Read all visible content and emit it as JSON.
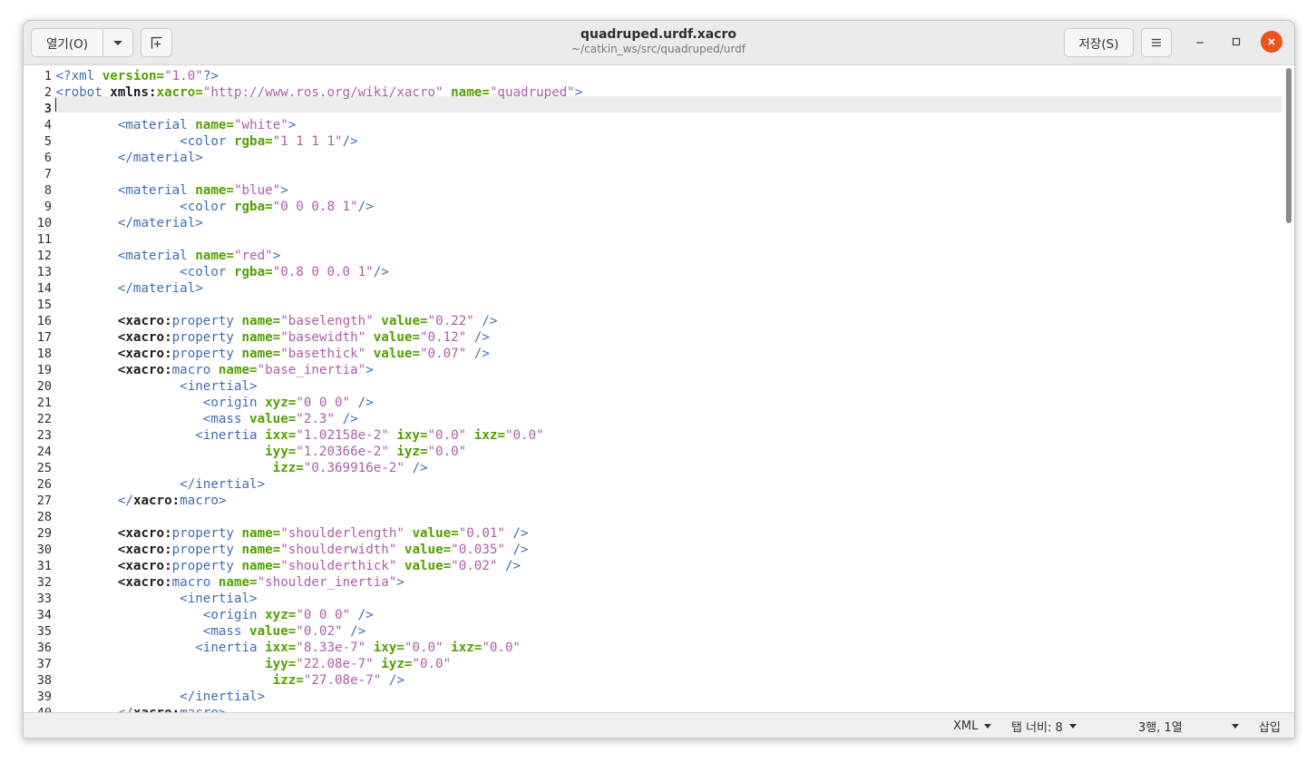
{
  "header": {
    "open_label": "열기(O)",
    "title": "quadruped.urdf.xacro",
    "subtitle": "~/catkin_ws/src/quadruped/urdf",
    "save_label": "저장(S)"
  },
  "icons": {
    "open_dropdown": "chevron-down-icon",
    "new_tab": "new-tab-icon",
    "menu": "hamburger-menu-icon",
    "minimize": "minimize-icon",
    "maximize": "maximize-icon",
    "close": "close-icon"
  },
  "colors": {
    "tag": "#3e6eb4",
    "attribute": "#52a000",
    "string": "#b05cab",
    "namespace": "#1c1c1c",
    "close_button": "#e95420",
    "current_line": "#ededed"
  },
  "editor": {
    "current_line": 3,
    "lines": [
      [
        [
          "t",
          "<?xml "
        ],
        [
          "a",
          "version="
        ],
        [
          "s",
          "\"1.0\""
        ],
        [
          "t",
          "?>"
        ]
      ],
      [
        [
          "t",
          "<robot "
        ],
        [
          "n",
          "xmlns:"
        ],
        [
          "a",
          "xacro="
        ],
        [
          "s",
          "\"http://www.ros.org/wiki/xacro\""
        ],
        [
          "p",
          " "
        ],
        [
          "a",
          "name="
        ],
        [
          "s",
          "\"quadruped\""
        ],
        [
          "t",
          ">"
        ]
      ],
      [],
      [
        [
          "p",
          "        "
        ],
        [
          "t",
          "<material "
        ],
        [
          "a",
          "name="
        ],
        [
          "s",
          "\"white\""
        ],
        [
          "t",
          ">"
        ]
      ],
      [
        [
          "p",
          "                "
        ],
        [
          "t",
          "<color "
        ],
        [
          "a",
          "rgba="
        ],
        [
          "s",
          "\"1 1 1 1\""
        ],
        [
          "t",
          "/>"
        ]
      ],
      [
        [
          "p",
          "        "
        ],
        [
          "t",
          "</material>"
        ]
      ],
      [],
      [
        [
          "p",
          "        "
        ],
        [
          "t",
          "<material "
        ],
        [
          "a",
          "name="
        ],
        [
          "s",
          "\"blue\""
        ],
        [
          "t",
          ">"
        ]
      ],
      [
        [
          "p",
          "                "
        ],
        [
          "t",
          "<color "
        ],
        [
          "a",
          "rgba="
        ],
        [
          "s",
          "\"0 0 0.8 1\""
        ],
        [
          "t",
          "/>"
        ]
      ],
      [
        [
          "p",
          "        "
        ],
        [
          "t",
          "</material>"
        ]
      ],
      [],
      [
        [
          "p",
          "        "
        ],
        [
          "t",
          "<material "
        ],
        [
          "a",
          "name="
        ],
        [
          "s",
          "\"red\""
        ],
        [
          "t",
          ">"
        ]
      ],
      [
        [
          "p",
          "                "
        ],
        [
          "t",
          "<color "
        ],
        [
          "a",
          "rgba="
        ],
        [
          "s",
          "\"0.8 0 0.0 1\""
        ],
        [
          "t",
          "/>"
        ]
      ],
      [
        [
          "p",
          "        "
        ],
        [
          "t",
          "</material>"
        ]
      ],
      [],
      [
        [
          "p",
          "        "
        ],
        [
          "n",
          "<xacro:"
        ],
        [
          "t",
          "property "
        ],
        [
          "a",
          "name="
        ],
        [
          "s",
          "\"baselength\""
        ],
        [
          "p",
          " "
        ],
        [
          "a",
          "value="
        ],
        [
          "s",
          "\"0.22\""
        ],
        [
          "p",
          " "
        ],
        [
          "t",
          "/>"
        ]
      ],
      [
        [
          "p",
          "        "
        ],
        [
          "n",
          "<xacro:"
        ],
        [
          "t",
          "property "
        ],
        [
          "a",
          "name="
        ],
        [
          "s",
          "\"basewidth\""
        ],
        [
          "p",
          " "
        ],
        [
          "a",
          "value="
        ],
        [
          "s",
          "\"0.12\""
        ],
        [
          "p",
          " "
        ],
        [
          "t",
          "/>"
        ]
      ],
      [
        [
          "p",
          "        "
        ],
        [
          "n",
          "<xacro:"
        ],
        [
          "t",
          "property "
        ],
        [
          "a",
          "name="
        ],
        [
          "s",
          "\"basethick\""
        ],
        [
          "p",
          " "
        ],
        [
          "a",
          "value="
        ],
        [
          "s",
          "\"0.07\""
        ],
        [
          "p",
          " "
        ],
        [
          "t",
          "/>"
        ]
      ],
      [
        [
          "p",
          "        "
        ],
        [
          "n",
          "<xacro:"
        ],
        [
          "t",
          "macro "
        ],
        [
          "a",
          "name="
        ],
        [
          "s",
          "\"base_inertia\""
        ],
        [
          "t",
          ">"
        ]
      ],
      [
        [
          "p",
          "                "
        ],
        [
          "t",
          "<inertial>"
        ]
      ],
      [
        [
          "p",
          "                   "
        ],
        [
          "t",
          "<origin "
        ],
        [
          "a",
          "xyz="
        ],
        [
          "s",
          "\"0 0 0\""
        ],
        [
          "p",
          " "
        ],
        [
          "t",
          "/>"
        ]
      ],
      [
        [
          "p",
          "                   "
        ],
        [
          "t",
          "<mass "
        ],
        [
          "a",
          "value="
        ],
        [
          "s",
          "\"2.3\""
        ],
        [
          "p",
          " "
        ],
        [
          "t",
          "/>"
        ]
      ],
      [
        [
          "p",
          "                  "
        ],
        [
          "t",
          "<inertia "
        ],
        [
          "a",
          "ixx="
        ],
        [
          "s",
          "\"1.02158e-2\""
        ],
        [
          "p",
          " "
        ],
        [
          "a",
          "ixy="
        ],
        [
          "s",
          "\"0.0\""
        ],
        [
          "p",
          " "
        ],
        [
          "a",
          "ixz="
        ],
        [
          "s",
          "\"0.0\""
        ]
      ],
      [
        [
          "p",
          "                           "
        ],
        [
          "a",
          "iyy="
        ],
        [
          "s",
          "\"1.20366e-2\""
        ],
        [
          "p",
          " "
        ],
        [
          "a",
          "iyz="
        ],
        [
          "s",
          "\"0.0\""
        ]
      ],
      [
        [
          "p",
          "                            "
        ],
        [
          "a",
          "izz="
        ],
        [
          "s",
          "\"0.369916e-2\""
        ],
        [
          "p",
          " "
        ],
        [
          "t",
          "/>"
        ]
      ],
      [
        [
          "p",
          "                "
        ],
        [
          "t",
          "</inertial>"
        ]
      ],
      [
        [
          "p",
          "        "
        ],
        [
          "t",
          "</"
        ],
        [
          "n",
          "xacro:"
        ],
        [
          "t",
          "macro>"
        ]
      ],
      [],
      [
        [
          "p",
          "        "
        ],
        [
          "n",
          "<xacro:"
        ],
        [
          "t",
          "property "
        ],
        [
          "a",
          "name="
        ],
        [
          "s",
          "\"shoulderlength\""
        ],
        [
          "p",
          " "
        ],
        [
          "a",
          "value="
        ],
        [
          "s",
          "\"0.01\""
        ],
        [
          "p",
          " "
        ],
        [
          "t",
          "/>"
        ]
      ],
      [
        [
          "p",
          "        "
        ],
        [
          "n",
          "<xacro:"
        ],
        [
          "t",
          "property "
        ],
        [
          "a",
          "name="
        ],
        [
          "s",
          "\"shoulderwidth\""
        ],
        [
          "p",
          " "
        ],
        [
          "a",
          "value="
        ],
        [
          "s",
          "\"0.035\""
        ],
        [
          "p",
          " "
        ],
        [
          "t",
          "/>"
        ]
      ],
      [
        [
          "p",
          "        "
        ],
        [
          "n",
          "<xacro:"
        ],
        [
          "t",
          "property "
        ],
        [
          "a",
          "name="
        ],
        [
          "s",
          "\"shoulderthick\""
        ],
        [
          "p",
          " "
        ],
        [
          "a",
          "value="
        ],
        [
          "s",
          "\"0.02\""
        ],
        [
          "p",
          " "
        ],
        [
          "t",
          "/>"
        ]
      ],
      [
        [
          "p",
          "        "
        ],
        [
          "n",
          "<xacro:"
        ],
        [
          "t",
          "macro "
        ],
        [
          "a",
          "name="
        ],
        [
          "s",
          "\"shoulder_inertia\""
        ],
        [
          "t",
          ">"
        ]
      ],
      [
        [
          "p",
          "                "
        ],
        [
          "t",
          "<inertial>"
        ]
      ],
      [
        [
          "p",
          "                   "
        ],
        [
          "t",
          "<origin "
        ],
        [
          "a",
          "xyz="
        ],
        [
          "s",
          "\"0 0 0\""
        ],
        [
          "p",
          " "
        ],
        [
          "t",
          "/>"
        ]
      ],
      [
        [
          "p",
          "                   "
        ],
        [
          "t",
          "<mass "
        ],
        [
          "a",
          "value="
        ],
        [
          "s",
          "\"0.02\""
        ],
        [
          "p",
          " "
        ],
        [
          "t",
          "/>"
        ]
      ],
      [
        [
          "p",
          "                  "
        ],
        [
          "t",
          "<inertia "
        ],
        [
          "a",
          "ixx="
        ],
        [
          "s",
          "\"8.33e-7\""
        ],
        [
          "p",
          " "
        ],
        [
          "a",
          "ixy="
        ],
        [
          "s",
          "\"0.0\""
        ],
        [
          "p",
          " "
        ],
        [
          "a",
          "ixz="
        ],
        [
          "s",
          "\"0.0\""
        ]
      ],
      [
        [
          "p",
          "                           "
        ],
        [
          "a",
          "iyy="
        ],
        [
          "s",
          "\"22.08e-7\""
        ],
        [
          "p",
          " "
        ],
        [
          "a",
          "iyz="
        ],
        [
          "s",
          "\"0.0\""
        ]
      ],
      [
        [
          "p",
          "                            "
        ],
        [
          "a",
          "izz="
        ],
        [
          "s",
          "\"27.08e-7\""
        ],
        [
          "p",
          " "
        ],
        [
          "t",
          "/>"
        ]
      ],
      [
        [
          "p",
          "                "
        ],
        [
          "t",
          "</inertial>"
        ]
      ],
      [
        [
          "p",
          "        "
        ],
        [
          "t",
          "</"
        ],
        [
          "n",
          "xacro:"
        ],
        [
          "t",
          "macro>"
        ]
      ]
    ]
  },
  "status": {
    "language": "XML",
    "tab_width": "탭 너비: 8",
    "position": "3행, 1열",
    "mode": "삽입"
  }
}
